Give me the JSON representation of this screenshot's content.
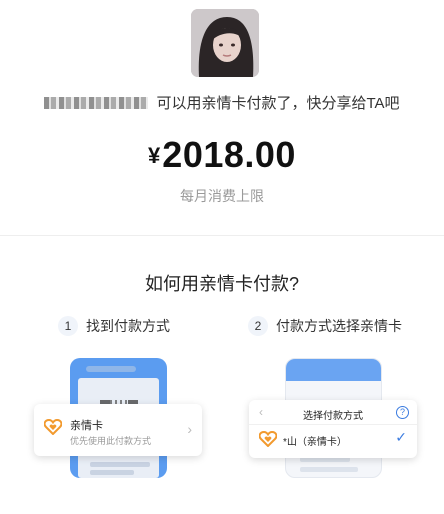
{
  "user": {
    "avatar_icon": "user-avatar-photo",
    "message": "可以用亲情卡付款了，快分享给TA吧"
  },
  "amount": {
    "currency": "¥",
    "value": "2018.00",
    "label": "每月消费上限"
  },
  "guide": {
    "title": "如何用亲情卡付款?",
    "steps": [
      {
        "number": "1",
        "label": "找到付款方式"
      },
      {
        "number": "2",
        "label": "付款方式选择亲情卡"
      }
    ],
    "card1": {
      "title": "亲情卡",
      "subtitle": "优先使用此付款方式",
      "icon": "heart-card-icon"
    },
    "card2": {
      "title": "选择付款方式",
      "option": "*山（亲情卡）",
      "icon": "heart-card-icon"
    }
  },
  "colors": {
    "accent_blue": "#3a7be0",
    "heart_orange": "#f29a2e"
  }
}
